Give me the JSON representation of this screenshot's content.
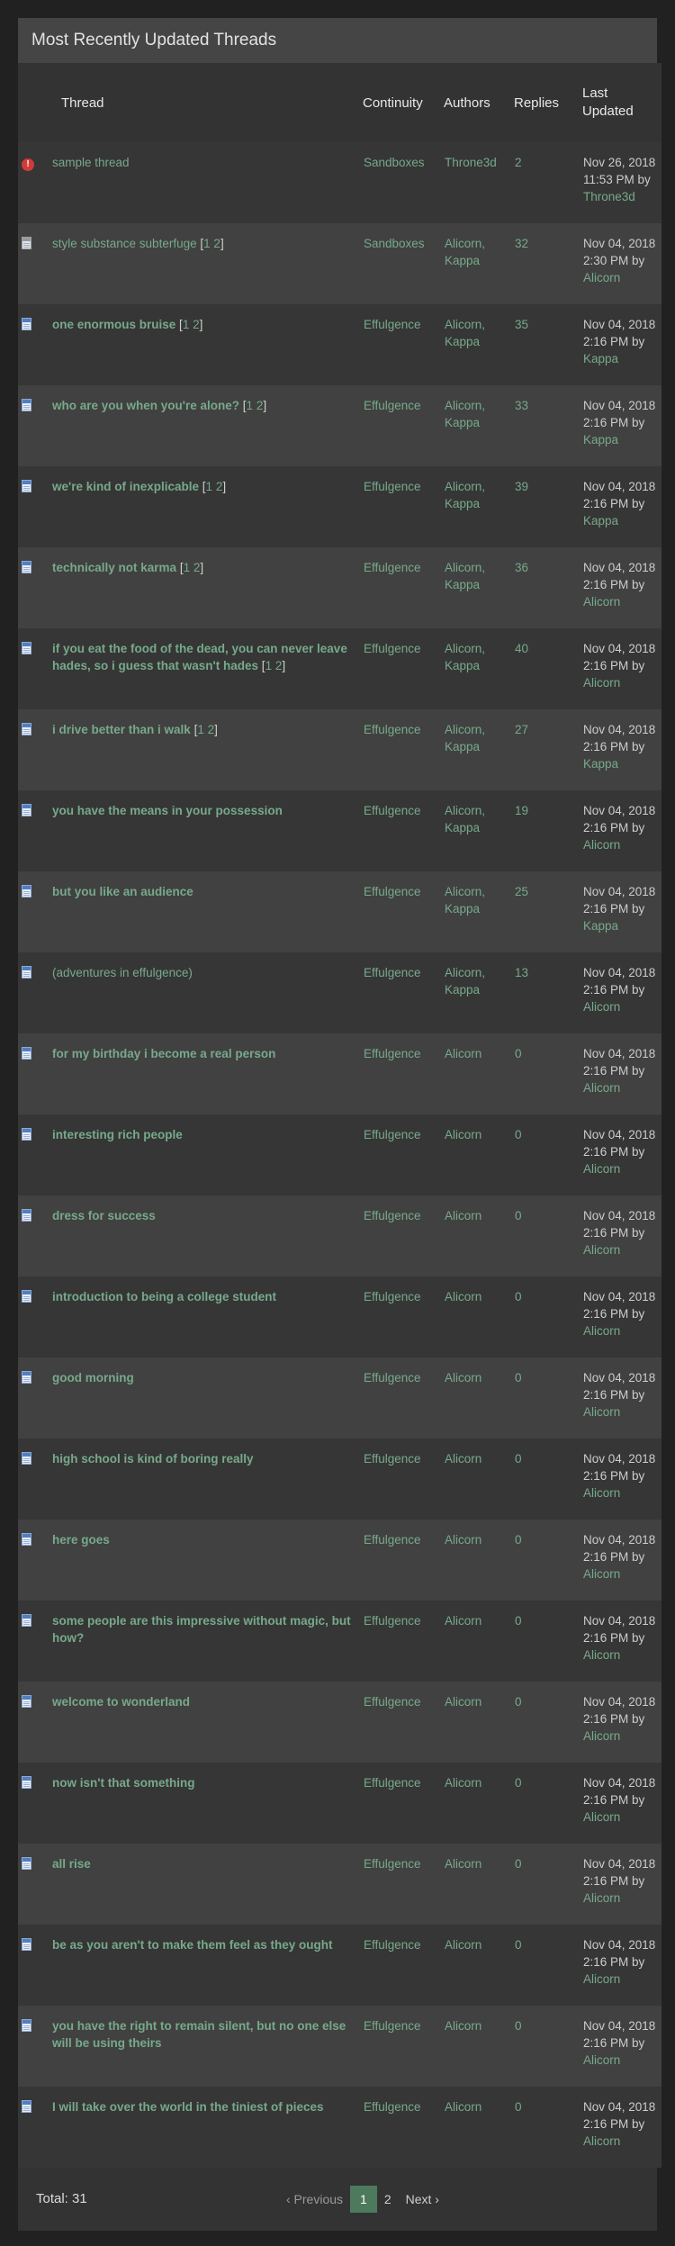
{
  "panel": {
    "title": "Most Recently Updated Threads"
  },
  "columns": {
    "thread": "Thread",
    "continuity": "Continuity",
    "authors": "Authors",
    "replies": "Replies",
    "last_updated": "Last Updated"
  },
  "threads": [
    {
      "icon": "alert-icon",
      "title": "sample thread",
      "bold": false,
      "pages": [],
      "continuity": "Sandboxes",
      "authors": "Throne3d",
      "replies": "2",
      "last": "Nov 26, 2018 11:53 PM by",
      "last_by": "Throne3d"
    },
    {
      "icon": "gray-doc-icon",
      "title": "style substance subterfuge",
      "bold": false,
      "pages": [
        "1",
        "2"
      ],
      "continuity": "Sandboxes",
      "authors": "Alicorn, Kappa",
      "replies": "32",
      "last": "Nov 04, 2018 2:30 PM by",
      "last_by": "Alicorn"
    },
    {
      "icon": "doc-icon",
      "title": "one enormous bruise",
      "bold": true,
      "pages": [
        "1",
        "2"
      ],
      "continuity": "Effulgence",
      "authors": "Alicorn, Kappa",
      "replies": "35",
      "last": "Nov 04, 2018 2:16 PM by",
      "last_by": "Kappa"
    },
    {
      "icon": "doc-icon",
      "title": "who are you when you're alone?",
      "bold": true,
      "pages": [
        "1",
        "2"
      ],
      "continuity": "Effulgence",
      "authors": "Alicorn, Kappa",
      "replies": "33",
      "last": "Nov 04, 2018 2:16 PM by",
      "last_by": "Kappa"
    },
    {
      "icon": "doc-icon",
      "title": "we're kind of inexplicable",
      "bold": true,
      "pages": [
        "1",
        "2"
      ],
      "continuity": "Effulgence",
      "authors": "Alicorn, Kappa",
      "replies": "39",
      "last": "Nov 04, 2018 2:16 PM by",
      "last_by": "Kappa"
    },
    {
      "icon": "doc-icon",
      "title": "technically not karma",
      "bold": true,
      "pages": [
        "1",
        "2"
      ],
      "continuity": "Effulgence",
      "authors": "Alicorn, Kappa",
      "replies": "36",
      "last": "Nov 04, 2018 2:16 PM by",
      "last_by": "Alicorn"
    },
    {
      "icon": "doc-icon",
      "title": "if you eat the food of the dead, you can never leave hades, so i guess that wasn't hades",
      "bold": true,
      "pages": [
        "1",
        "2"
      ],
      "continuity": "Effulgence",
      "authors": "Alicorn, Kappa",
      "replies": "40",
      "last": "Nov 04, 2018 2:16 PM by",
      "last_by": "Alicorn"
    },
    {
      "icon": "doc-icon",
      "title": "i drive better than i walk",
      "bold": true,
      "pages": [
        "1",
        "2"
      ],
      "continuity": "Effulgence",
      "authors": "Alicorn, Kappa",
      "replies": "27",
      "last": "Nov 04, 2018 2:16 PM by",
      "last_by": "Kappa"
    },
    {
      "icon": "doc-icon",
      "title": "you have the means in your possession",
      "bold": true,
      "pages": [],
      "continuity": "Effulgence",
      "authors": "Alicorn, Kappa",
      "replies": "19",
      "last": "Nov 04, 2018 2:16 PM by",
      "last_by": "Alicorn"
    },
    {
      "icon": "doc-icon",
      "title": "but you like an audience",
      "bold": true,
      "pages": [],
      "continuity": "Effulgence",
      "authors": "Alicorn, Kappa",
      "replies": "25",
      "last": "Nov 04, 2018 2:16 PM by",
      "last_by": "Kappa"
    },
    {
      "icon": "doc-icon",
      "title": "(adventures in effulgence)",
      "bold": false,
      "pages": [],
      "continuity": "Effulgence",
      "authors": "Alicorn, Kappa",
      "replies": "13",
      "last": "Nov 04, 2018 2:16 PM by",
      "last_by": "Alicorn"
    },
    {
      "icon": "doc-icon",
      "title": "for my birthday i become a real person",
      "bold": true,
      "pages": [],
      "continuity": "Effulgence",
      "authors": "Alicorn",
      "replies": "0",
      "last": "Nov 04, 2018 2:16 PM by",
      "last_by": "Alicorn"
    },
    {
      "icon": "doc-icon",
      "title": "interesting rich people",
      "bold": true,
      "pages": [],
      "continuity": "Effulgence",
      "authors": "Alicorn",
      "replies": "0",
      "last": "Nov 04, 2018 2:16 PM by",
      "last_by": "Alicorn"
    },
    {
      "icon": "doc-icon",
      "title": "dress for success",
      "bold": true,
      "pages": [],
      "continuity": "Effulgence",
      "authors": "Alicorn",
      "replies": "0",
      "last": "Nov 04, 2018 2:16 PM by",
      "last_by": "Alicorn"
    },
    {
      "icon": "doc-icon",
      "title": "introduction to being a college student",
      "bold": true,
      "pages": [],
      "continuity": "Effulgence",
      "authors": "Alicorn",
      "replies": "0",
      "last": "Nov 04, 2018 2:16 PM by",
      "last_by": "Alicorn"
    },
    {
      "icon": "doc-icon",
      "title": "good morning",
      "bold": true,
      "pages": [],
      "continuity": "Effulgence",
      "authors": "Alicorn",
      "replies": "0",
      "last": "Nov 04, 2018 2:16 PM by",
      "last_by": "Alicorn"
    },
    {
      "icon": "doc-icon",
      "title": "high school is kind of boring really",
      "bold": true,
      "pages": [],
      "continuity": "Effulgence",
      "authors": "Alicorn",
      "replies": "0",
      "last": "Nov 04, 2018 2:16 PM by",
      "last_by": "Alicorn"
    },
    {
      "icon": "doc-icon",
      "title": "here goes",
      "bold": true,
      "pages": [],
      "continuity": "Effulgence",
      "authors": "Alicorn",
      "replies": "0",
      "last": "Nov 04, 2018 2:16 PM by",
      "last_by": "Alicorn"
    },
    {
      "icon": "doc-icon",
      "title": "some people are this impressive without magic, but how?",
      "bold": true,
      "pages": [],
      "continuity": "Effulgence",
      "authors": "Alicorn",
      "replies": "0",
      "last": "Nov 04, 2018 2:16 PM by",
      "last_by": "Alicorn"
    },
    {
      "icon": "doc-icon",
      "title": "welcome to wonderland",
      "bold": true,
      "pages": [],
      "continuity": "Effulgence",
      "authors": "Alicorn",
      "replies": "0",
      "last": "Nov 04, 2018 2:16 PM by",
      "last_by": "Alicorn"
    },
    {
      "icon": "doc-icon",
      "title": "now isn't that something",
      "bold": true,
      "pages": [],
      "continuity": "Effulgence",
      "authors": "Alicorn",
      "replies": "0",
      "last": "Nov 04, 2018 2:16 PM by",
      "last_by": "Alicorn"
    },
    {
      "icon": "doc-icon",
      "title": "all rise",
      "bold": true,
      "pages": [],
      "continuity": "Effulgence",
      "authors": "Alicorn",
      "replies": "0",
      "last": "Nov 04, 2018 2:16 PM by",
      "last_by": "Alicorn"
    },
    {
      "icon": "doc-icon",
      "title": "be as you aren't to make them feel as they ought",
      "bold": true,
      "pages": [],
      "continuity": "Effulgence",
      "authors": "Alicorn",
      "replies": "0",
      "last": "Nov 04, 2018 2:16 PM by",
      "last_by": "Alicorn"
    },
    {
      "icon": "doc-icon",
      "title": "you have the right to remain silent, but no one else will be using theirs",
      "bold": true,
      "pages": [],
      "continuity": "Effulgence",
      "authors": "Alicorn",
      "replies": "0",
      "last": "Nov 04, 2018 2:16 PM by",
      "last_by": "Alicorn"
    },
    {
      "icon": "doc-icon",
      "title": "I will take over the world in the tiniest of pieces",
      "bold": true,
      "pages": [],
      "continuity": "Effulgence",
      "authors": "Alicorn",
      "replies": "0",
      "last": "Nov 04, 2018 2:16 PM by",
      "last_by": "Alicorn"
    }
  ],
  "footer": {
    "total": "Total: 31",
    "pager": {
      "prev": "‹ Previous",
      "pages": [
        "1",
        "2"
      ],
      "current": "1",
      "next": "Next ›"
    }
  }
}
